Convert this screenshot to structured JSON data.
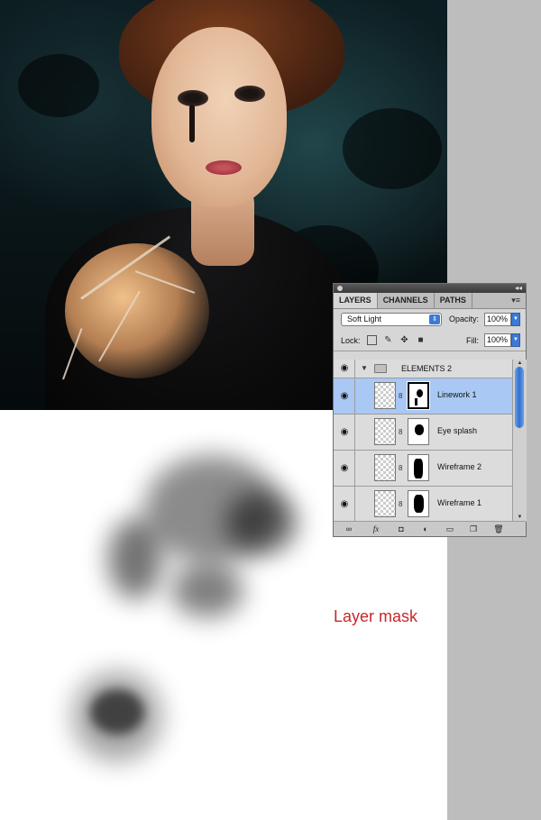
{
  "panel": {
    "tabs": [
      "LAYERS",
      "CHANNELS",
      "PATHS"
    ],
    "blend_mode": "Soft Light",
    "opacity_label": "Opacity:",
    "opacity_value": "100%",
    "lock_label": "Lock:",
    "fill_label": "Fill:",
    "fill_value": "100%",
    "group_name": "ELEMENTS 2",
    "layers": [
      {
        "name": "Linework 1",
        "selected": true
      },
      {
        "name": "Eye splash",
        "selected": false
      },
      {
        "name": "Wireframe 2",
        "selected": false
      },
      {
        "name": "Wireframe 1",
        "selected": false
      }
    ]
  },
  "annotation": {
    "label": "Layer mask",
    "color": "#c62828"
  },
  "colors": {
    "selection": "#a9c8f3",
    "accent": "#3d7ad6",
    "gutter": "#bdbdbd"
  },
  "icons": {
    "visibility": "eye-icon",
    "link": "chain-icon",
    "group": "folder-icon"
  }
}
